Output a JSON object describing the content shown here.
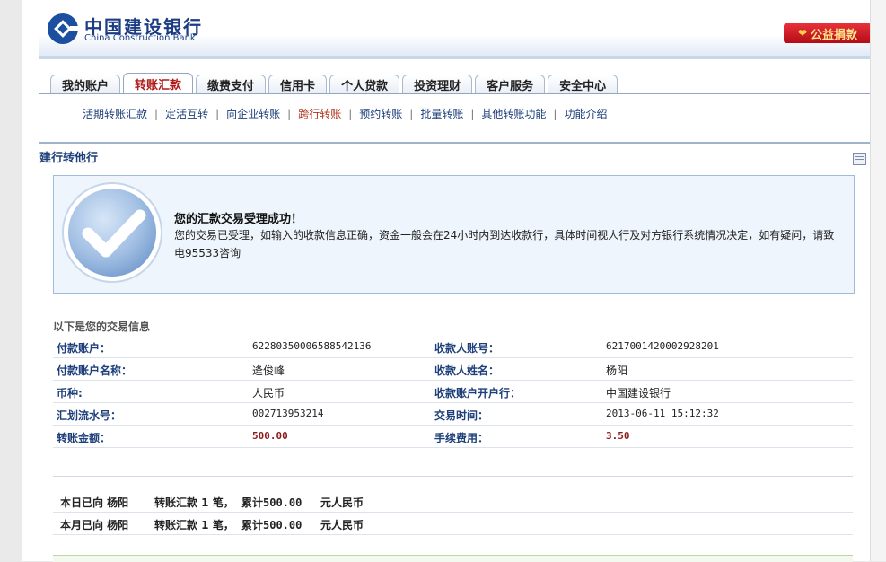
{
  "header": {
    "logo_cn": "中国建设银行",
    "logo_en": "China Construction Bank",
    "charity_label": "公益捐款"
  },
  "tabs": [
    {
      "label": "我的账户"
    },
    {
      "label": "转账汇款",
      "active": true
    },
    {
      "label": "缴费支付"
    },
    {
      "label": "信用卡"
    },
    {
      "label": "个人贷款"
    },
    {
      "label": "投资理财"
    },
    {
      "label": "客户服务"
    },
    {
      "label": "安全中心"
    }
  ],
  "subnav": [
    {
      "label": "活期转账汇款"
    },
    {
      "label": "定活互转"
    },
    {
      "label": "向企业转账"
    },
    {
      "label": "跨行转账",
      "active": true
    },
    {
      "label": "预约转账"
    },
    {
      "label": "批量转账"
    },
    {
      "label": "其他转账功能"
    },
    {
      "label": "功能介绍"
    }
  ],
  "section": {
    "title": "建行转他行"
  },
  "success": {
    "title": "您的汇款交易受理成功！",
    "message": "您的交易已受理，如输入的收款信息正确，资金一般会在24小时内到达收款行，具体时间视人行及对方银行系统情况决定，如有疑问，请致电95533咨询"
  },
  "info": {
    "heading": "以下是您的交易信息",
    "rows": [
      {
        "l1": "付款账户：",
        "v1": "6228035000658854213​6",
        "l2": "收款人账号：",
        "v2": "6217001420002928201"
      },
      {
        "l1": "付款账户名称：",
        "v1": "逄俊峰",
        "l2": "收款人姓名：",
        "v2": "杨阳"
      },
      {
        "l1": "币种:",
        "v1": "人民币",
        "l2": "收款账户开户行：",
        "v2": "中国建设银行"
      },
      {
        "l1": "汇划流水号：",
        "v1": "002713953214",
        "l2": "交易时间：",
        "v2": "2013-06-11 15:12:32"
      },
      {
        "l1": "转账金额：",
        "v1": "500.00",
        "l2": "手续费用：",
        "v2": "3.50"
      }
    ]
  },
  "summary": [
    {
      "a": "本日已向 杨阳",
      "b": "转账汇款 1 笔，",
      "c": "累计500.00",
      "d": "元人民币"
    },
    {
      "a": "本月已向 杨阳",
      "b": "转账汇款 1 笔，",
      "c": "累计500.00",
      "d": "元人民币"
    }
  ]
}
